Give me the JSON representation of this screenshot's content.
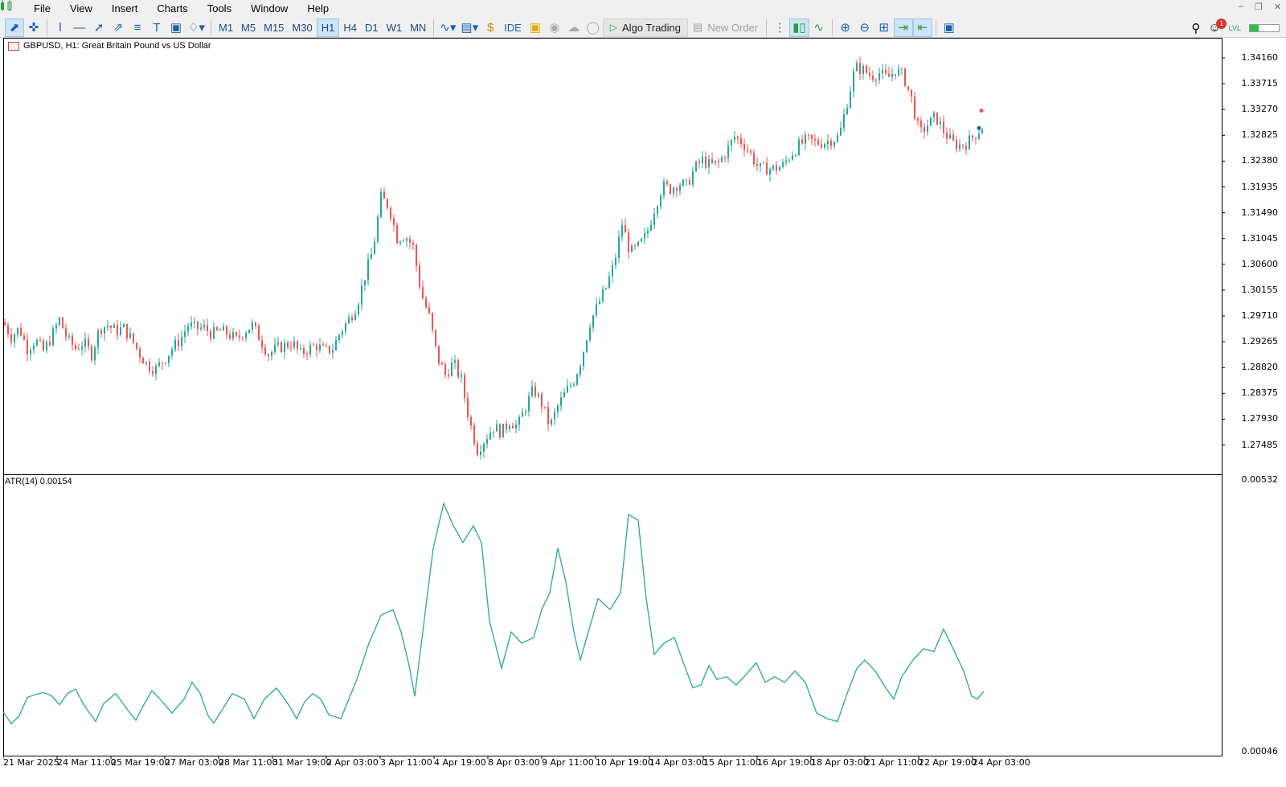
{
  "menu": {
    "items": [
      {
        "label": "File"
      },
      {
        "label": "View"
      },
      {
        "label": "Insert"
      },
      {
        "label": "Charts"
      },
      {
        "label": "Tools"
      },
      {
        "label": "Window"
      },
      {
        "label": "Help"
      }
    ]
  },
  "toolbar": {
    "timeframes": [
      {
        "label": "M1"
      },
      {
        "label": "M5"
      },
      {
        "label": "M15"
      },
      {
        "label": "M30"
      },
      {
        "label": "H1"
      },
      {
        "label": "H4"
      },
      {
        "label": "D1"
      },
      {
        "label": "W1"
      },
      {
        "label": "MN"
      }
    ],
    "selected_timeframe": "H1",
    "ide_label": "IDE",
    "algo_trading_label": "Algo Trading",
    "new_order_label": "New Order",
    "notification_count": "1",
    "lvl_label": "LVL"
  },
  "chart": {
    "symbol_caption": "GBPUSD, H1:  Great Britain Pound vs US Dollar",
    "price_ticks": [
      "1.34160",
      "1.33715",
      "1.33270",
      "1.32825",
      "1.32380",
      "1.31935",
      "1.31490",
      "1.31045",
      "1.30600",
      "1.30155",
      "1.29710",
      "1.29265",
      "1.28820",
      "1.28375",
      "1.27930",
      "1.27485"
    ],
    "atr_label": "ATR(14) 0.00154",
    "atr_ticks": [
      "0.00532",
      "0.00046"
    ],
    "time_ticks": [
      "21 Mar 2025",
      "24 Mar 11:00",
      "25 Mar 19:00",
      "27 Mar 03:00",
      "28 Mar 11:00",
      "31 Mar 19:00",
      "2 Apr 03:00",
      "3 Apr 11:00",
      "4 Apr 19:00",
      "8 Apr 03:00",
      "9 Apr 11:00",
      "10 Apr 19:00",
      "14 Apr 03:00",
      "15 Apr 11:00",
      "16 Apr 19:00",
      "18 Apr 03:00",
      "21 Apr 11:00",
      "22 Apr 19:00",
      "24 Apr 03:00"
    ],
    "colors": {
      "bull": "#26a69a",
      "bear": "#ef5350",
      "atr": "#26a69a",
      "frame": "#000000"
    }
  },
  "chart_data": {
    "type": "candlestick",
    "symbol": "GBPUSD",
    "timeframe": "H1",
    "price_range": [
      1.2716,
      1.3434
    ],
    "close_path": [
      [
        0,
        1.296
      ],
      [
        10,
        1.2935
      ],
      [
        20,
        1.295
      ],
      [
        30,
        1.2915
      ],
      [
        40,
        1.293
      ],
      [
        50,
        1.291
      ],
      [
        60,
        1.2935
      ],
      [
        70,
        1.2965
      ],
      [
        80,
        1.293
      ],
      [
        90,
        1.2915
      ],
      [
        100,
        1.2925
      ],
      [
        110,
        1.2905
      ],
      [
        120,
        1.295
      ],
      [
        130,
        1.2955
      ],
      [
        140,
        1.2945
      ],
      [
        150,
        1.295
      ],
      [
        160,
        1.293
      ],
      [
        170,
        1.2905
      ],
      [
        180,
        1.2885
      ],
      [
        190,
        1.288
      ],
      [
        200,
        1.2895
      ],
      [
        210,
        1.2915
      ],
      [
        220,
        1.293
      ],
      [
        230,
        1.2955
      ],
      [
        240,
        1.295
      ],
      [
        250,
        1.295
      ],
      [
        260,
        1.294
      ],
      [
        270,
        1.2945
      ],
      [
        280,
        1.294
      ],
      [
        290,
        1.293
      ],
      [
        300,
        1.2945
      ],
      [
        310,
        1.2955
      ],
      [
        320,
        1.293
      ],
      [
        330,
        1.2905
      ],
      [
        340,
        1.2915
      ],
      [
        350,
        1.292
      ],
      [
        360,
        1.2925
      ],
      [
        370,
        1.2905
      ],
      [
        380,
        1.2915
      ],
      [
        390,
        1.292
      ],
      [
        400,
        1.291
      ],
      [
        410,
        1.2915
      ],
      [
        420,
        1.2945
      ],
      [
        430,
        1.2965
      ],
      [
        440,
        1.299
      ],
      [
        450,
        1.304
      ],
      [
        460,
        1.3085
      ],
      [
        470,
        1.3175
      ],
      [
        480,
        1.316
      ],
      [
        490,
        1.3105
      ],
      [
        500,
        1.311
      ],
      [
        510,
        1.309
      ],
      [
        520,
        1.301
      ],
      [
        530,
        1.297
      ],
      [
        540,
        1.29
      ],
      [
        550,
        1.287
      ],
      [
        560,
        1.289
      ],
      [
        570,
        1.286
      ],
      [
        580,
        1.279
      ],
      [
        590,
        1.274
      ],
      [
        600,
        1.276
      ],
      [
        610,
        1.278
      ],
      [
        620,
        1.277
      ],
      [
        630,
        1.279
      ],
      [
        640,
        1.278
      ],
      [
        650,
        1.2815
      ],
      [
        660,
        1.2845
      ],
      [
        670,
        1.282
      ],
      [
        680,
        1.278
      ],
      [
        690,
        1.2815
      ],
      [
        700,
        1.284
      ],
      [
        710,
        1.286
      ],
      [
        720,
        1.29
      ],
      [
        730,
        1.296
      ],
      [
        740,
        1.299
      ],
      [
        750,
        1.302
      ],
      [
        760,
        1.306
      ],
      [
        770,
        1.313
      ],
      [
        780,
        1.308
      ],
      [
        790,
        1.309
      ],
      [
        800,
        1.311
      ],
      [
        810,
        1.3155
      ],
      [
        820,
        1.3195
      ],
      [
        830,
        1.319
      ],
      [
        840,
        1.32
      ],
      [
        850,
        1.3195
      ],
      [
        860,
        1.3225
      ],
      [
        870,
        1.324
      ],
      [
        880,
        1.323
      ],
      [
        890,
        1.3235
      ],
      [
        900,
        1.3255
      ],
      [
        910,
        1.328
      ],
      [
        920,
        1.327
      ],
      [
        930,
        1.325
      ],
      [
        940,
        1.3225
      ],
      [
        950,
        1.3225
      ],
      [
        960,
        1.3225
      ],
      [
        970,
        1.323
      ],
      [
        980,
        1.325
      ],
      [
        990,
        1.3265
      ],
      [
        1000,
        1.3275
      ],
      [
        1010,
        1.327
      ],
      [
        1020,
        1.327
      ],
      [
        1030,
        1.3275
      ],
      [
        1040,
        1.328
      ],
      [
        1050,
        1.334
      ],
      [
        1060,
        1.34
      ],
      [
        1070,
        1.3395
      ],
      [
        1080,
        1.3385
      ],
      [
        1090,
        1.339
      ],
      [
        1100,
        1.338
      ],
      [
        1110,
        1.3395
      ],
      [
        1120,
        1.3385
      ],
      [
        1130,
        1.3345
      ],
      [
        1140,
        1.3285
      ],
      [
        1150,
        1.33
      ],
      [
        1160,
        1.3315
      ],
      [
        1170,
        1.329
      ],
      [
        1180,
        1.327
      ],
      [
        1190,
        1.3265
      ],
      [
        1200,
        1.327
      ],
      [
        1210,
        1.3285
      ],
      [
        1220,
        1.33
      ]
    ],
    "atr_range": [
      0.00046,
      0.00532
    ],
    "atr_path": [
      [
        0,
        0.00117
      ],
      [
        10,
        0.00096
      ],
      [
        20,
        0.0011
      ],
      [
        30,
        0.00143
      ],
      [
        40,
        0.00148
      ],
      [
        50,
        0.00152
      ],
      [
        60,
        0.00146
      ],
      [
        70,
        0.0013
      ],
      [
        80,
        0.0015
      ],
      [
        90,
        0.00158
      ],
      [
        100,
        0.0013
      ],
      [
        110,
        0.0011
      ],
      [
        115,
        0.001
      ],
      [
        125,
        0.00132
      ],
      [
        140,
        0.0015
      ],
      [
        155,
        0.0012
      ],
      [
        165,
        0.00102
      ],
      [
        175,
        0.0013
      ],
      [
        185,
        0.00155
      ],
      [
        195,
        0.0014
      ],
      [
        210,
        0.00115
      ],
      [
        225,
        0.0014
      ],
      [
        235,
        0.0017
      ],
      [
        245,
        0.0015
      ],
      [
        255,
        0.0011
      ],
      [
        262,
        0.00097
      ],
      [
        272,
        0.0012
      ],
      [
        285,
        0.0015
      ],
      [
        300,
        0.0014
      ],
      [
        312,
        0.00105
      ],
      [
        325,
        0.0014
      ],
      [
        340,
        0.0016
      ],
      [
        355,
        0.0013
      ],
      [
        365,
        0.00105
      ],
      [
        375,
        0.00135
      ],
      [
        385,
        0.0015
      ],
      [
        395,
        0.0014
      ],
      [
        405,
        0.00112
      ],
      [
        420,
        0.00105
      ],
      [
        440,
        0.00175
      ],
      [
        455,
        0.0024
      ],
      [
        470,
        0.0029
      ],
      [
        485,
        0.003
      ],
      [
        495,
        0.0026
      ],
      [
        505,
        0.002
      ],
      [
        512,
        0.00145
      ],
      [
        522,
        0.0026
      ],
      [
        535,
        0.0041
      ],
      [
        548,
        0.0049
      ],
      [
        560,
        0.0045
      ],
      [
        572,
        0.0042
      ],
      [
        585,
        0.0045
      ],
      [
        595,
        0.0042
      ],
      [
        605,
        0.0028
      ],
      [
        620,
        0.00195
      ],
      [
        632,
        0.0026
      ],
      [
        645,
        0.0024
      ],
      [
        660,
        0.0025
      ],
      [
        670,
        0.003
      ],
      [
        680,
        0.0033
      ],
      [
        690,
        0.0041
      ],
      [
        700,
        0.0035
      ],
      [
        710,
        0.0026
      ],
      [
        718,
        0.0021
      ],
      [
        728,
        0.0026
      ],
      [
        740,
        0.0032
      ],
      [
        755,
        0.003
      ],
      [
        768,
        0.0033
      ],
      [
        778,
        0.0047
      ],
      [
        790,
        0.0046
      ],
      [
        800,
        0.0032
      ],
      [
        810,
        0.0022
      ],
      [
        822,
        0.0024
      ],
      [
        835,
        0.0025
      ],
      [
        845,
        0.0021
      ],
      [
        858,
        0.0016
      ],
      [
        868,
        0.00165
      ],
      [
        878,
        0.002
      ],
      [
        888,
        0.00175
      ],
      [
        900,
        0.0018
      ],
      [
        912,
        0.00165
      ],
      [
        925,
        0.00185
      ],
      [
        937,
        0.00205
      ],
      [
        948,
        0.0017
      ],
      [
        960,
        0.0018
      ],
      [
        972,
        0.0017
      ],
      [
        985,
        0.0019
      ],
      [
        998,
        0.0017
      ],
      [
        1012,
        0.00115
      ],
      [
        1025,
        0.00105
      ],
      [
        1038,
        0.001
      ],
      [
        1050,
        0.0015
      ],
      [
        1062,
        0.00195
      ],
      [
        1072,
        0.0021
      ],
      [
        1085,
        0.0019
      ],
      [
        1098,
        0.0016
      ],
      [
        1108,
        0.0014
      ],
      [
        1118,
        0.0018
      ],
      [
        1132,
        0.0021
      ],
      [
        1145,
        0.0023
      ],
      [
        1158,
        0.00225
      ],
      [
        1170,
        0.00265
      ],
      [
        1182,
        0.0023
      ],
      [
        1195,
        0.0019
      ],
      [
        1205,
        0.00145
      ],
      [
        1212,
        0.0014
      ],
      [
        1220,
        0.00154
      ]
    ],
    "last_atr": 0.00154
  }
}
